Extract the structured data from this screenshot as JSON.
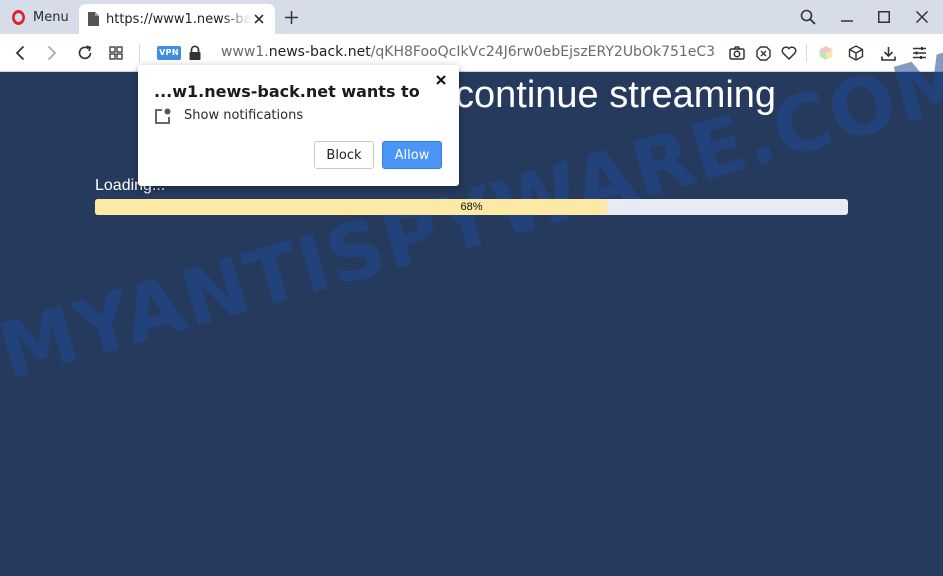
{
  "browser": {
    "menu_label": "Menu",
    "tab_title": "https://www1.news-back.net/qKH8FooQcIkVc24J6rw0ebEjszERY2UbOk751eC3",
    "vpn_label": "VPN",
    "url": {
      "prefix": "www1.",
      "host": "news-back.net",
      "path": "/qKH8FooQcIkVc24J6rw0ebEjszERY2UbOk751eC3"
    }
  },
  "page": {
    "headline": "continue streaming",
    "loading_label": "Loading...",
    "progress": {
      "percent": 68,
      "label": "68%"
    },
    "watermark": "MYANTISPYWARE.COM"
  },
  "popup": {
    "title": "...w1.news-back.net wants to",
    "permission_label": "Show notifications",
    "block_label": "Block",
    "allow_label": "Allow"
  },
  "colors": {
    "page_background": "#263a5e",
    "allow_button": "#4a95f5",
    "progress_fill": "#fde9a6",
    "vpn_badge": "#3f8fe0"
  }
}
